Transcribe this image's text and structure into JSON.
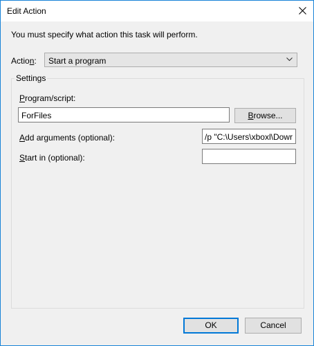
{
  "window": {
    "title": "Edit Action",
    "close_icon": "close-icon"
  },
  "instruction": "You must specify what action this task will perform.",
  "action": {
    "label": "Action:",
    "selected": "Start a program"
  },
  "settings": {
    "label": "Settings",
    "program_label": "Program/script:",
    "program_value": "ForFiles",
    "browse_label": "Browse...",
    "args_label": "Add arguments (optional):",
    "args_value": "/p \"C:\\Users\\xboxl\\Dowr",
    "start_in_label": "Start in (optional):",
    "start_in_value": ""
  },
  "buttons": {
    "ok": "OK",
    "cancel": "Cancel"
  },
  "colors": {
    "accent": "#0078d7",
    "border": "#1883d7",
    "dialog_bg": "#f0f0f0"
  }
}
